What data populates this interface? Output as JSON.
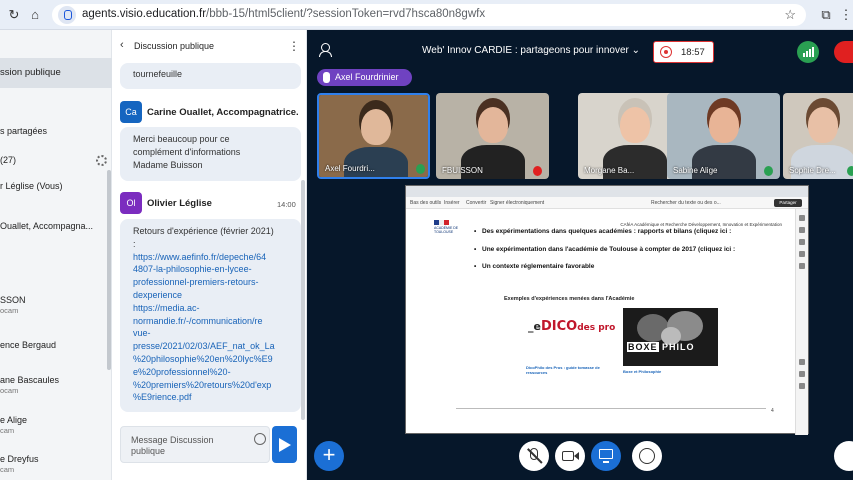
{
  "browser": {
    "url_host": "agents.visio.education.fr",
    "url_path": "/bbb-15/html5client/?sessionToken=rvd7hsca80n8gwfx"
  },
  "userlist": {
    "active_label": "ssion publique",
    "items": [
      {
        "label": "s partagées"
      },
      {
        "label": "(27)"
      },
      {
        "label": "r Léglise (Vous)"
      },
      {
        "label": "Ouallet, Accompagna..."
      },
      {
        "label": "SSON"
      },
      {
        "label": "ence Bergaud"
      },
      {
        "label": "ane Bascaules"
      },
      {
        "label": "e Alige",
        "sub": "cam"
      },
      {
        "label": "e Dreyfus",
        "sub": "cam"
      }
    ],
    "extra_subs": [
      "ocam",
      "ocam"
    ]
  },
  "chat": {
    "title": "Discussion publique",
    "partial_top": "tournefeuille",
    "messages": [
      {
        "initials": "Ca",
        "avatar_color": "#1565c0",
        "sender": "Carine Ouallet, Accompagnatrice...",
        "lines": [
          "Merci beaucoup pour ce",
          "complément d'informations",
          "Madame Buisson"
        ]
      },
      {
        "initials": "Ol",
        "avatar_color": "#7b2cbf",
        "sender": "Olivier Léglise",
        "time": "14:00",
        "lines": [
          "Retours d'expérience (février 2021)",
          ":"
        ],
        "links": [
          "https://www.aefinfo.fr/depeche/64",
          "4807-la-philosophie-en-lycee-",
          "professionnel-premiers-retours-",
          "dexperience",
          "https://media.ac-",
          "normandie.fr/-/communication/re",
          "vue-",
          "presse/2021/02/03/AEF_nat_ok_La",
          "%20philosophie%20en%20lyc%E9",
          "e%20professionnel%20-",
          "%20premiers%20retours%20d'exp",
          "%E9rience.pdf"
        ]
      }
    ],
    "composer_placeholder": "Message Discussion publique"
  },
  "meeting": {
    "title": "Web' Innov CARDIE : partageons pour innover",
    "record_time": "18:57",
    "talking": "Axel Fourdrinier",
    "participants": [
      {
        "name": "Axel Fourdri...",
        "bg": "#8a6a4a",
        "skin": "#e0b89a",
        "hair": "#3b2a1c",
        "shirt": "#2b3f52"
      },
      {
        "name": "FBUISSON",
        "bg": "#b8b2a6",
        "skin": "#e3b69a",
        "hair": "#4a3022",
        "shirt": "#222222"
      },
      {
        "name": "Morgane Ba...",
        "bg": "#d8d4cc",
        "skin": "#eec3a7",
        "hair": "#c9c2b7",
        "shirt": "#2c2c2c"
      },
      {
        "name": "Sabine Alige",
        "bg": "#a9b7c0",
        "skin": "#e8b496",
        "hair": "#6e3a24",
        "shirt": "#333a44"
      },
      {
        "name": "Sophie Dre...",
        "bg": "#cfc8bd",
        "skin": "#e8c0a6",
        "hair": "#6b4a33",
        "shirt": "#cfd6de"
      }
    ],
    "presentation": {
      "toolbar_items": [
        "Bas des outils",
        "Insérer",
        "Convertir",
        "Signer électroniquement",
        "Rechercher du texte ou des o..."
      ],
      "share_label": "Partager",
      "header": "CAféA Académique et Recherche Développement, Innovation et Expérimentation",
      "logo_text": "ACADÉMIE DE TOULOUSE",
      "bullets": [
        "Des expérimentations dans quelques académies : rapports et bilans (cliquez ici :",
        "Une expérimentation dans l'académie de Toulouse à compter de 2017 (cliquez ici :",
        "Un contexte réglementaire favorable"
      ],
      "caption": "Exemples d'expériences menées dans l'Académie",
      "dico_text": "DICO",
      "dico_suffix": "des pro",
      "boxe_a": "BOXE",
      "boxe_b": "PHILO",
      "desc_left_title": "DicoPhilo des Pros : guide tomasse de ressources",
      "desc_right_title": "Boxe et Philosophie",
      "page_num": "4"
    }
  }
}
